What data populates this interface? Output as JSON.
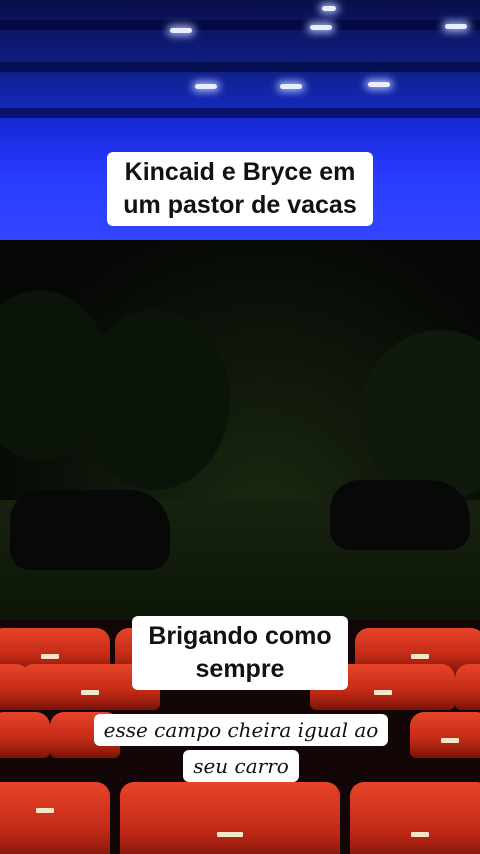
{
  "captions": {
    "top": "Kincaid e Bryce em um pastor de vacas",
    "middle_line1": "Brigando como",
    "middle_line2": "sempre",
    "italic": "esse campo cheira igual ao seu carro"
  },
  "colors": {
    "ceiling_blue": "#2a3cff",
    "seat_red": "#d8371f",
    "caption_bg": "#ffffff",
    "caption_text": "#111111"
  }
}
